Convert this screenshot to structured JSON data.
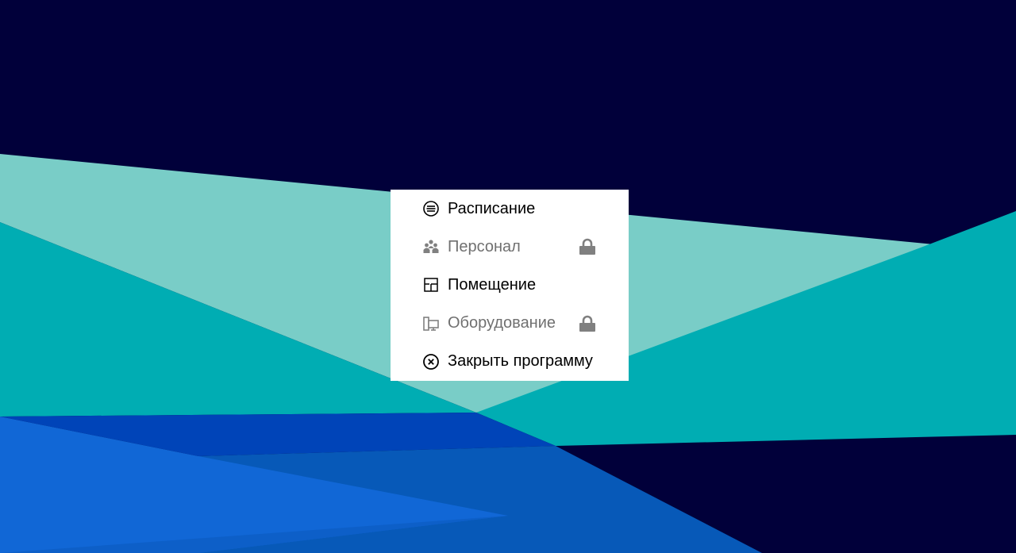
{
  "desktop": {
    "colors": {
      "background": "#01003a",
      "light_teal": "#79cdc7",
      "teal": "#00adb3",
      "blue": "#1167d6",
      "mid_blue": "#0759b8",
      "deep_blue": "#0044b8"
    }
  },
  "menu": {
    "items": [
      {
        "label": "Расписание",
        "icon": "list-circle-icon",
        "enabled": true,
        "locked": false
      },
      {
        "label": "Персонал",
        "icon": "people-icon",
        "enabled": false,
        "locked": true
      },
      {
        "label": "Помещение",
        "icon": "floor-plan-icon",
        "enabled": true,
        "locked": false
      },
      {
        "label": "Оборудование",
        "icon": "computer-icon",
        "enabled": false,
        "locked": true
      },
      {
        "label": "Закрыть программу",
        "icon": "close-circle-icon",
        "enabled": true,
        "locked": false
      }
    ],
    "colors": {
      "background": "#ffffff",
      "enabled_text": "#000000",
      "disabled_text": "#707070",
      "lock": "#808080"
    }
  }
}
